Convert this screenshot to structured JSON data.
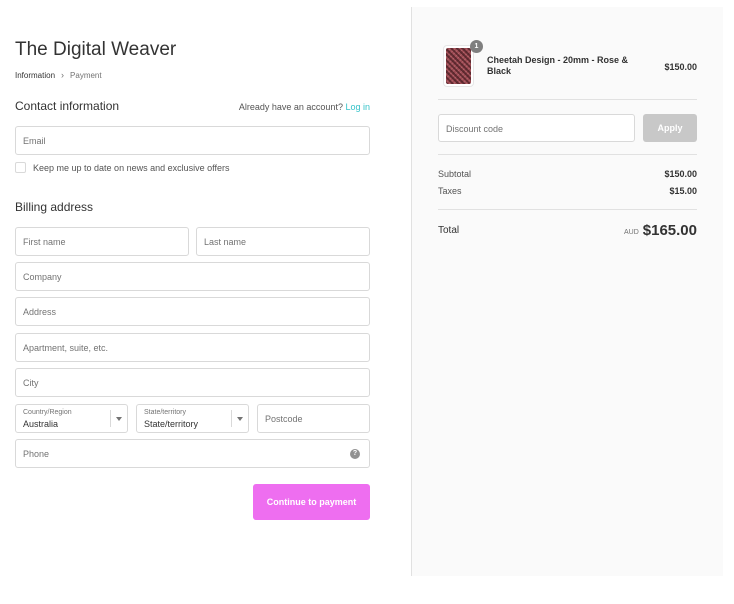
{
  "shop": {
    "title": "The Digital Weaver"
  },
  "breadcrumb": {
    "current": "Information",
    "separator": "›",
    "next": "Payment"
  },
  "contact": {
    "title": "Contact information",
    "account_prompt": "Already have an account?",
    "login_link": "Log in",
    "email_placeholder": "Email",
    "newsletter_label": "Keep me up to date on news and exclusive offers",
    "newsletter_checked": false
  },
  "billing": {
    "title": "Billing address",
    "first_name_placeholder": "First name",
    "last_name_placeholder": "Last name",
    "company_placeholder": "Company",
    "address_placeholder": "Address",
    "apartment_placeholder": "Apartment, suite, etc.",
    "city_placeholder": "City",
    "country_label": "Country/Region",
    "country_value": "Australia",
    "state_label": "State/territory",
    "state_value": "State/territory",
    "postcode_placeholder": "Postcode",
    "phone_placeholder": "Phone",
    "help_icon": "?"
  },
  "actions": {
    "continue_label": "Continue to payment"
  },
  "order": {
    "items": [
      {
        "name": "Cheetah Design - 20mm - Rose & Black",
        "price": "$150.00",
        "quantity": "1"
      }
    ],
    "discount_placeholder": "Discount code",
    "apply_label": "Apply",
    "subtotal_label": "Subtotal",
    "subtotal_value": "$150.00",
    "taxes_label": "Taxes",
    "taxes_value": "$15.00",
    "total_label": "Total",
    "currency": "AUD",
    "total_value": "$165.00"
  },
  "colors": {
    "accent_button": "#ee6ef0",
    "link": "#35c3c9",
    "disabled_button": "#c8c8c8",
    "sidebar_bg": "#fafafa"
  },
  "icons": {
    "breadcrumb_separator": "chevron-right-icon",
    "phone_help": "question-circle-icon",
    "select_arrow": "caret-down-icon"
  }
}
